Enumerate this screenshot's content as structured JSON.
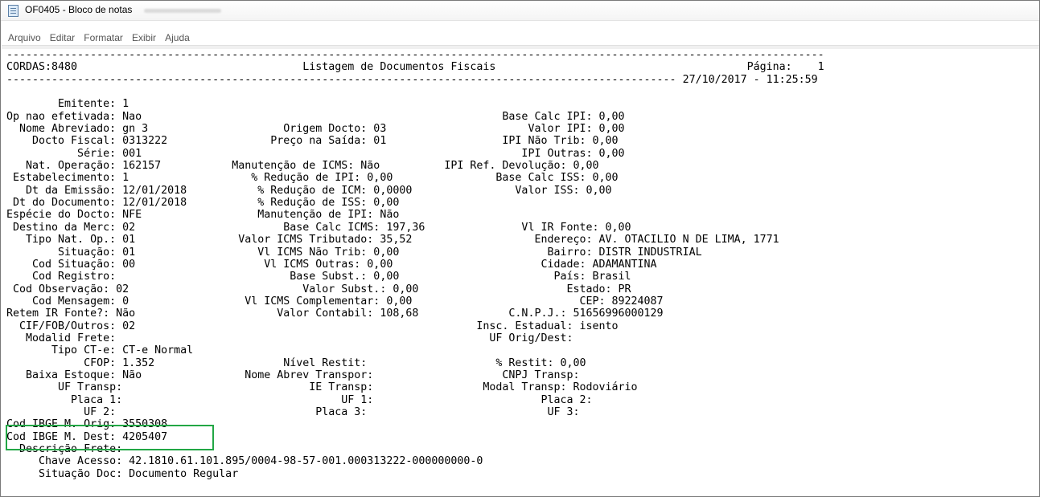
{
  "window": {
    "title": "OF0405 - Bloco de notas",
    "icon": "notepad-icon"
  },
  "menu": [
    "Arquivo",
    "Editar",
    "Formatar",
    "Exibir",
    "Ajuda"
  ],
  "report": {
    "lines": [
      "-------------------------------------------------------------------------------------------------------------------------------",
      "CORDAS:8480                                   Listagem de Documentos Fiscais                                       Página:    1",
      "-------------------------------------------------------------------------------------------------------- 27/10/2017 - 11:25:59",
      "",
      "        Emitente: 1",
      "Op nao efetivada: Nao                                                        Base Calc IPI: 0,00",
      "  Nome Abreviado: gn 3                     Origem Docto: 03                      Valor IPI: 0,00",
      "    Docto Fiscal: 0313222                Preço na Saída: 01                  IPI Não Trib: 0,00",
      "           Série: 001                                                           IPI Outras: 0,00",
      "   Nat. Operação: 162157           Manutenção de ICMS: Não          IPI Ref. Devolução: 0,00",
      " Estabelecimento: 1                   % Redução de IPI: 0,00                Base Calc ISS: 0,00",
      "   Dt da Emissão: 12/01/2018           % Redução de ICM: 0,0000                Valor ISS: 0,00",
      " Dt do Documento: 12/01/2018           % Redução de ISS: 0,00",
      "Espécie do Docto: NFE                  Manutenção de IPI: Não",
      " Destino da Merc: 02                       Base Calc ICMS: 197,36               Vl IR Fonte: 0,00",
      "   Tipo Nat. Op.: 01                Valor ICMS Tributado: 35,52                   Endereço: AV. OTACILIO N DE LIMA, 1771",
      "        Situação: 01                   Vl ICMS Não Trib: 0,00                       Bairro: DISTR INDUSTRIAL",
      "    Cod Situação: 00                    Vl ICMS Outras: 0,00                       Cidade: ADAMANTINA",
      "    Cod Registro:                           Base Subst.: 0,00                        País: Brasil",
      " Cod Observação: 02                           Valor Subst.: 0,00                       Estado: PR",
      "    Cod Mensagem: 0                  Vl ICMS Complementar: 0,00                          CEP: 89224087",
      "Retem IR Fonte?: Não                      Valor Contabil: 108,68              C.N.P.J.: 51656996000129",
      "  CIF/FOB/Outros: 02                                                     Insc. Estadual: isento",
      "   Modalid Frete:                                                          UF Orig/Dest:",
      "       Tipo CT-e: CT-e Normal",
      "            CFOP: 1.352                    Nível Restit:                    % Restit: 0,00",
      "   Baixa Estoque: Não                Nome Abrev Transpor:                    CNPJ Transp:",
      "        UF Transp:                             IE Transp:                 Modal Transp: Rodoviário",
      "          Placa 1:                                  UF 1:                          Placa 2:",
      "            UF 2:                               Placa 3:                            UF 3:",
      "Cod IBGE M. Orig: 3550308",
      "Cod IBGE M. Dest: 4205407",
      "  Descrição Frete:",
      "     Chave Acesso: 42.1810.61.101.895/0004-98-57-001.000313222-000000000-0",
      "     Situação Doc: Documento Regular"
    ]
  },
  "colors": {
    "highlight_border": "#22a745",
    "menu_text": "#555555"
  }
}
